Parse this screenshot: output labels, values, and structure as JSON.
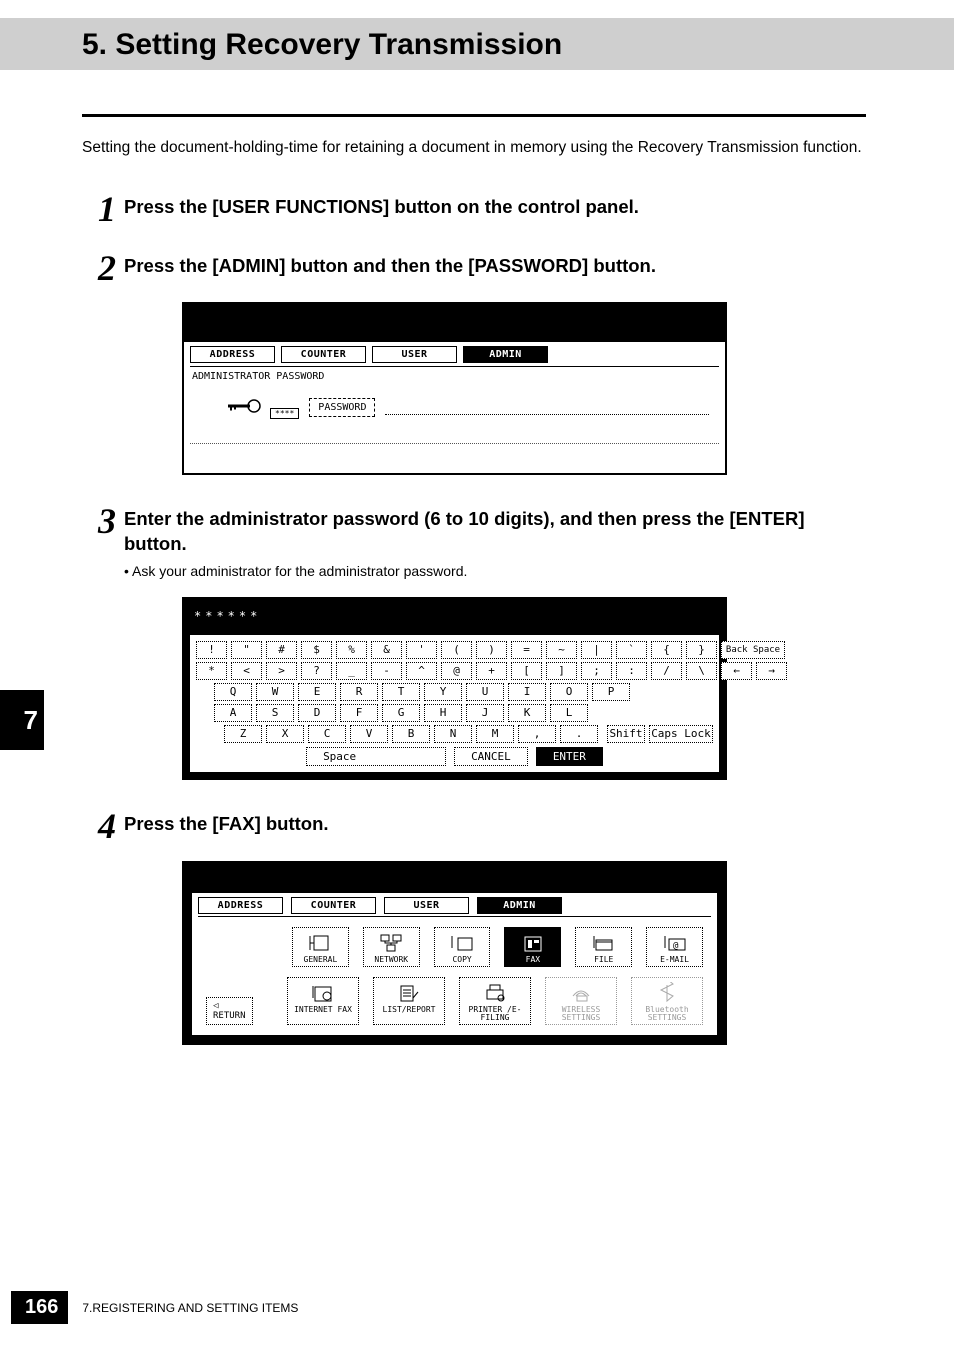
{
  "header": {
    "title": "5. Setting Recovery Transmission"
  },
  "intro": "Setting the document-holding-time for retaining a document in memory using the Recovery Transmission function.",
  "steps": [
    {
      "num": "1",
      "title": "Press the [USER FUNCTIONS] button on the control panel."
    },
    {
      "num": "2",
      "title": "Press the [ADMIN] button and then the [PASSWORD] button."
    },
    {
      "num": "3",
      "title": "Enter the administrator password (6 to 10 digits), and then press the [ENTER] button.",
      "note": "•  Ask your administrator for the administrator password."
    },
    {
      "num": "4",
      "title": "Press the [FAX] button."
    }
  ],
  "shot1": {
    "tabs": [
      "ADDRESS",
      "COUNTER",
      "USER",
      "ADMIN"
    ],
    "activeTab": 3,
    "subtitle": "ADMINISTRATOR PASSWORD",
    "keymask": "****",
    "pwdButton": "PASSWORD"
  },
  "shot2": {
    "entry": "******",
    "row1": [
      "!",
      "\"",
      "#",
      "$",
      "%",
      "&",
      "'",
      "(",
      ")",
      "=",
      "~",
      "|",
      "`",
      "{",
      "}"
    ],
    "backspace": "Back Space",
    "row2": [
      "*",
      "<",
      ">",
      "?",
      "_",
      "-",
      "^",
      "@",
      "+",
      "[",
      "]",
      ";",
      ":",
      "/",
      "\\"
    ],
    "arrowL": "←",
    "arrowR": "→",
    "row3": [
      "Q",
      "W",
      "E",
      "R",
      "T",
      "Y",
      "U",
      "I",
      "O",
      "P"
    ],
    "row4": [
      "A",
      "S",
      "D",
      "F",
      "G",
      "H",
      "J",
      "K",
      "L"
    ],
    "row5": [
      "Z",
      "X",
      "C",
      "V",
      "B",
      "N",
      "M",
      ",",
      "."
    ],
    "shift": "Shift",
    "caps": "Caps Lock",
    "space": "Space",
    "cancel": "CANCEL",
    "enter": "ENTER"
  },
  "shot3": {
    "tabs": [
      "ADDRESS",
      "COUNTER",
      "USER",
      "ADMIN"
    ],
    "activeTab": 3,
    "row1": [
      "GENERAL",
      "NETWORK",
      "COPY",
      "FAX",
      "FILE",
      "E-MAIL"
    ],
    "row1active": 3,
    "row2": [
      "INTERNET FAX",
      "LIST/REPORT",
      "PRINTER\n/E-FILING",
      "WIRELESS\nSETTINGS",
      "Bluetooth\nSETTINGS"
    ],
    "row2disabled": [
      3,
      4
    ],
    "return": "RETURN"
  },
  "chapter": "7",
  "footer": {
    "page": "166",
    "text": "7.REGISTERING AND SETTING ITEMS"
  }
}
